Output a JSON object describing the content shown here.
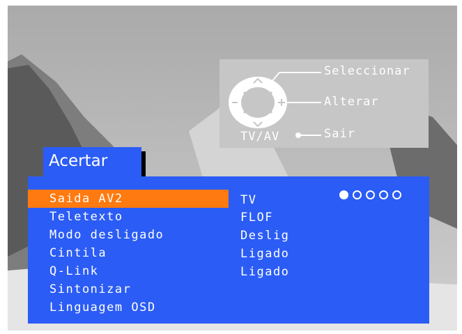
{
  "colors": {
    "panel_blue": "#2b5cf5",
    "selection_orange": "#ff7a10",
    "guide_grey": "#c6c6c6"
  },
  "guide": {
    "select_label": "Seleccionar",
    "change_label": "Alterar",
    "exit_label": "Sair",
    "tvav_label": "TV/AV"
  },
  "menu": {
    "title": "Acertar",
    "items": [
      {
        "label": "Saida AV2",
        "value": "TV",
        "selected": true
      },
      {
        "label": "Teletexto",
        "value": "FLOF"
      },
      {
        "label": "Modo desligado",
        "value": "Deslig"
      },
      {
        "label": "Cintila",
        "value": "Ligado"
      },
      {
        "label": "Q-Link",
        "value": "Ligado"
      },
      {
        "label": "Sintonizar",
        "value": ""
      },
      {
        "label": "Linguagem OSD",
        "value": ""
      }
    ],
    "page_indicator": {
      "current": 1,
      "total": 5
    }
  }
}
